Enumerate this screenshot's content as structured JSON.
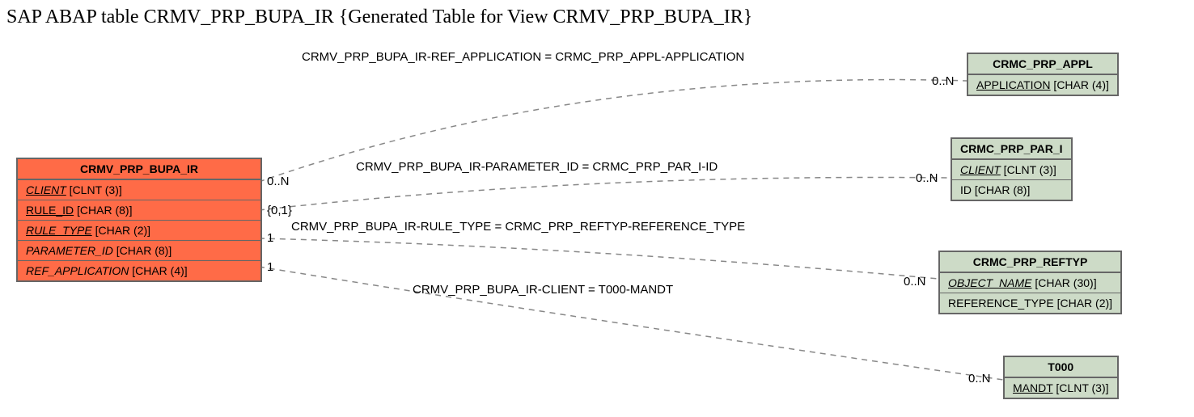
{
  "title": "SAP ABAP table CRMV_PRP_BUPA_IR {Generated Table for View CRMV_PRP_BUPA_IR}",
  "main": {
    "name": "CRMV_PRP_BUPA_IR",
    "fields": [
      {
        "name": "CLIENT",
        "type": "[CLNT (3)]",
        "ital": true,
        "und": true
      },
      {
        "name": "RULE_ID",
        "type": "[CHAR (8)]",
        "ital": false,
        "und": true
      },
      {
        "name": "RULE_TYPE",
        "type": "[CHAR (2)]",
        "ital": true,
        "und": true
      },
      {
        "name": "PARAMETER_ID",
        "type": "[CHAR (8)]",
        "ital": true,
        "und": false
      },
      {
        "name": "REF_APPLICATION",
        "type": "[CHAR (4)]",
        "ital": true,
        "und": false
      }
    ]
  },
  "rel": [
    {
      "label": "CRMV_PRP_BUPA_IR-REF_APPLICATION = CRMC_PRP_APPL-APPLICATION",
      "cl": "0..N",
      "cr": "0..N"
    },
    {
      "label": "CRMV_PRP_BUPA_IR-PARAMETER_ID = CRMC_PRP_PAR_I-ID",
      "cl": "{0,1}",
      "cr": "0..N"
    },
    {
      "label": "CRMV_PRP_BUPA_IR-RULE_TYPE = CRMC_PRP_REFTYP-REFERENCE_TYPE",
      "cl": "1",
      "cr": "0..N"
    },
    {
      "label": "CRMV_PRP_BUPA_IR-CLIENT = T000-MANDT",
      "cl": "1",
      "cr": "0..N"
    }
  ],
  "right": [
    {
      "name": "CRMC_PRP_APPL",
      "fields": [
        {
          "name": "APPLICATION",
          "type": "[CHAR (4)]",
          "ital": false,
          "und": true
        }
      ]
    },
    {
      "name": "CRMC_PRP_PAR_I",
      "fields": [
        {
          "name": "CLIENT",
          "type": "[CLNT (3)]",
          "ital": true,
          "und": true
        },
        {
          "name": "ID",
          "type": "[CHAR (8)]",
          "ital": false,
          "und": false
        }
      ]
    },
    {
      "name": "CRMC_PRP_REFTYP",
      "fields": [
        {
          "name": "OBJECT_NAME",
          "type": "[CHAR (30)]",
          "ital": true,
          "und": true
        },
        {
          "name": "REFERENCE_TYPE",
          "type": "[CHAR (2)]",
          "ital": false,
          "und": false
        }
      ]
    },
    {
      "name": "T000",
      "fields": [
        {
          "name": "MANDT",
          "type": "[CLNT (3)]",
          "ital": false,
          "und": true
        }
      ]
    }
  ],
  "chart_data": {
    "type": "erd",
    "entities": [
      {
        "name": "CRMV_PRP_BUPA_IR",
        "fields": [
          "CLIENT CLNT(3)",
          "RULE_ID CHAR(8)",
          "RULE_TYPE CHAR(2)",
          "PARAMETER_ID CHAR(8)",
          "REF_APPLICATION CHAR(4)"
        ]
      },
      {
        "name": "CRMC_PRP_APPL",
        "fields": [
          "APPLICATION CHAR(4)"
        ]
      },
      {
        "name": "CRMC_PRP_PAR_I",
        "fields": [
          "CLIENT CLNT(3)",
          "ID CHAR(8)"
        ]
      },
      {
        "name": "CRMC_PRP_REFTYP",
        "fields": [
          "OBJECT_NAME CHAR(30)",
          "REFERENCE_TYPE CHAR(2)"
        ]
      },
      {
        "name": "T000",
        "fields": [
          "MANDT CLNT(3)"
        ]
      }
    ],
    "relationships": [
      {
        "from": "CRMV_PRP_BUPA_IR.REF_APPLICATION",
        "to": "CRMC_PRP_APPL.APPLICATION",
        "card_from": "0..N",
        "card_to": "0..N"
      },
      {
        "from": "CRMV_PRP_BUPA_IR.PARAMETER_ID",
        "to": "CRMC_PRP_PAR_I.ID",
        "card_from": "{0,1}",
        "card_to": "0..N"
      },
      {
        "from": "CRMV_PRP_BUPA_IR.RULE_TYPE",
        "to": "CRMC_PRP_REFTYP.REFERENCE_TYPE",
        "card_from": "1",
        "card_to": "0..N"
      },
      {
        "from": "CRMV_PRP_BUPA_IR.CLIENT",
        "to": "T000.MANDT",
        "card_from": "1",
        "card_to": "0..N"
      }
    ]
  }
}
